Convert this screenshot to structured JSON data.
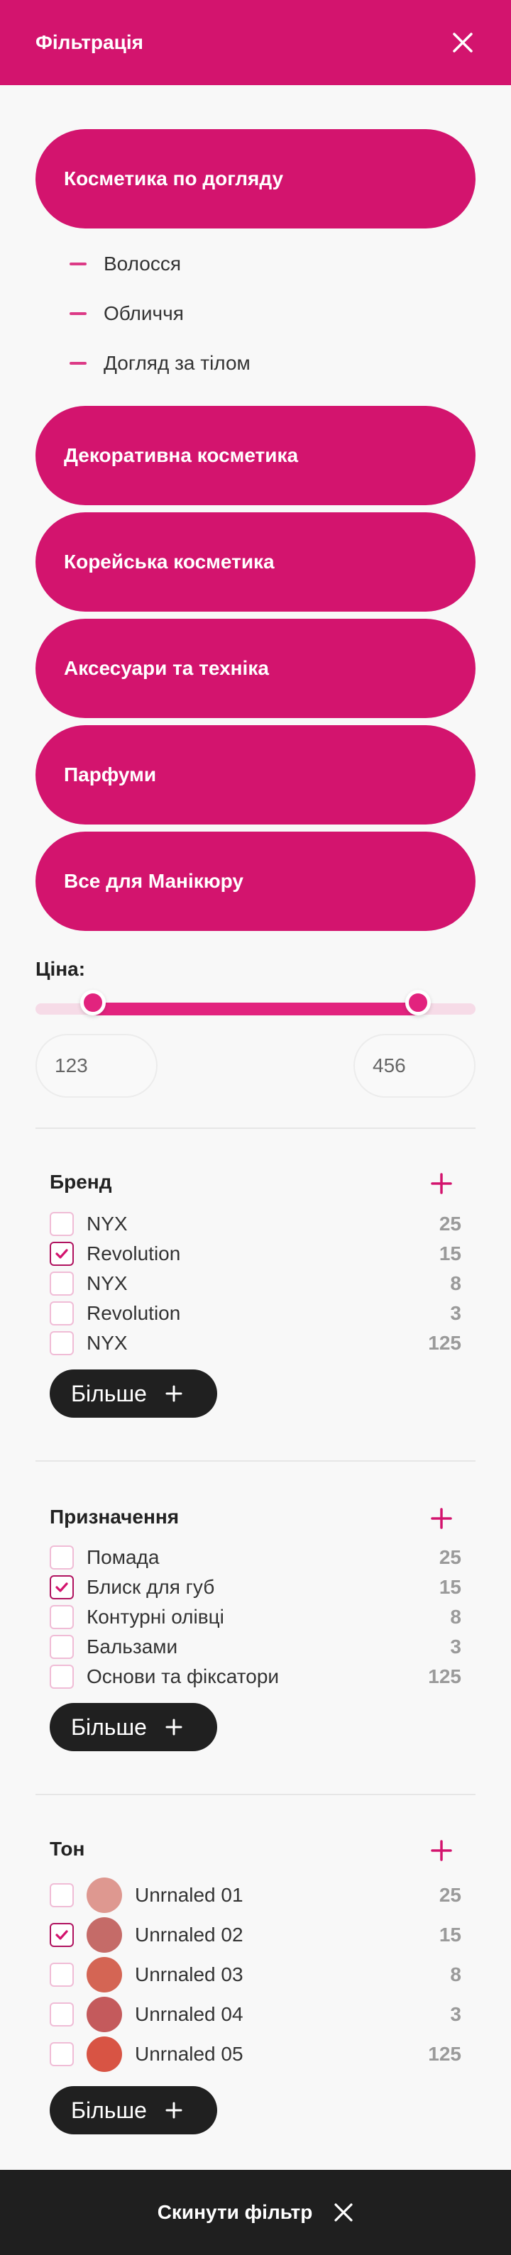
{
  "header": {
    "title": "Фільтрація",
    "close_icon": "close-icon"
  },
  "categories": [
    {
      "label": "Косметика по догляду",
      "expanded": true,
      "subitems": [
        {
          "label": "Волосся"
        },
        {
          "label": "Обличчя"
        },
        {
          "label": "Догляд за тілом"
        }
      ]
    },
    {
      "label": "Декоративна косметика"
    },
    {
      "label": "Корейська косметика"
    },
    {
      "label": "Аксесуари та техніка"
    },
    {
      "label": "Парфуми"
    },
    {
      "label": "Все для Манікюру"
    }
  ],
  "price": {
    "label": "Ціна:",
    "min_value": "123",
    "max_value": "456",
    "range_start_fraction": 0.13,
    "range_end_fraction": 0.87
  },
  "groups": {
    "brand": {
      "title": "Бренд",
      "items": [
        {
          "name": "NYX",
          "count": "25",
          "checked": false
        },
        {
          "name": "Revolution",
          "count": "15",
          "checked": true
        },
        {
          "name": "NYX",
          "count": "8",
          "checked": false
        },
        {
          "name": "Revolution",
          "count": "3",
          "checked": false
        },
        {
          "name": "NYX",
          "count": "125",
          "checked": false
        }
      ],
      "more_label": "Більше"
    },
    "purpose": {
      "title": "Призначення",
      "items": [
        {
          "name": "Помада",
          "count": "25",
          "checked": false
        },
        {
          "name": "Блиск для губ",
          "count": "15",
          "checked": true
        },
        {
          "name": "Контурні олівці",
          "count": "8",
          "checked": false
        },
        {
          "name": "Бальзами",
          "count": "3",
          "checked": false
        },
        {
          "name": "Основи та фіксатори",
          "count": "125",
          "checked": false
        }
      ],
      "more_label": "Більше"
    },
    "tone": {
      "title": "Тон",
      "items": [
        {
          "name": "Unrnaled 01",
          "count": "25",
          "checked": false,
          "color": "#de9890"
        },
        {
          "name": "Unrnaled 02",
          "count": "15",
          "checked": true,
          "color": "#c56b68"
        },
        {
          "name": "Unrnaled 03",
          "count": "8",
          "checked": false,
          "color": "#d46554"
        },
        {
          "name": "Unrnaled 04",
          "count": "3",
          "checked": false,
          "color": "#c45a5c"
        },
        {
          "name": "Unrnaled 05",
          "count": "125",
          "checked": false,
          "color": "#d85444"
        }
      ],
      "more_label": "Більше"
    }
  },
  "footer": {
    "reset_label": "Скинути фільтр"
  },
  "colors": {
    "brand": "#d3146e",
    "accent": "#e2237e",
    "dark": "#202020",
    "check": "#b0125f"
  }
}
